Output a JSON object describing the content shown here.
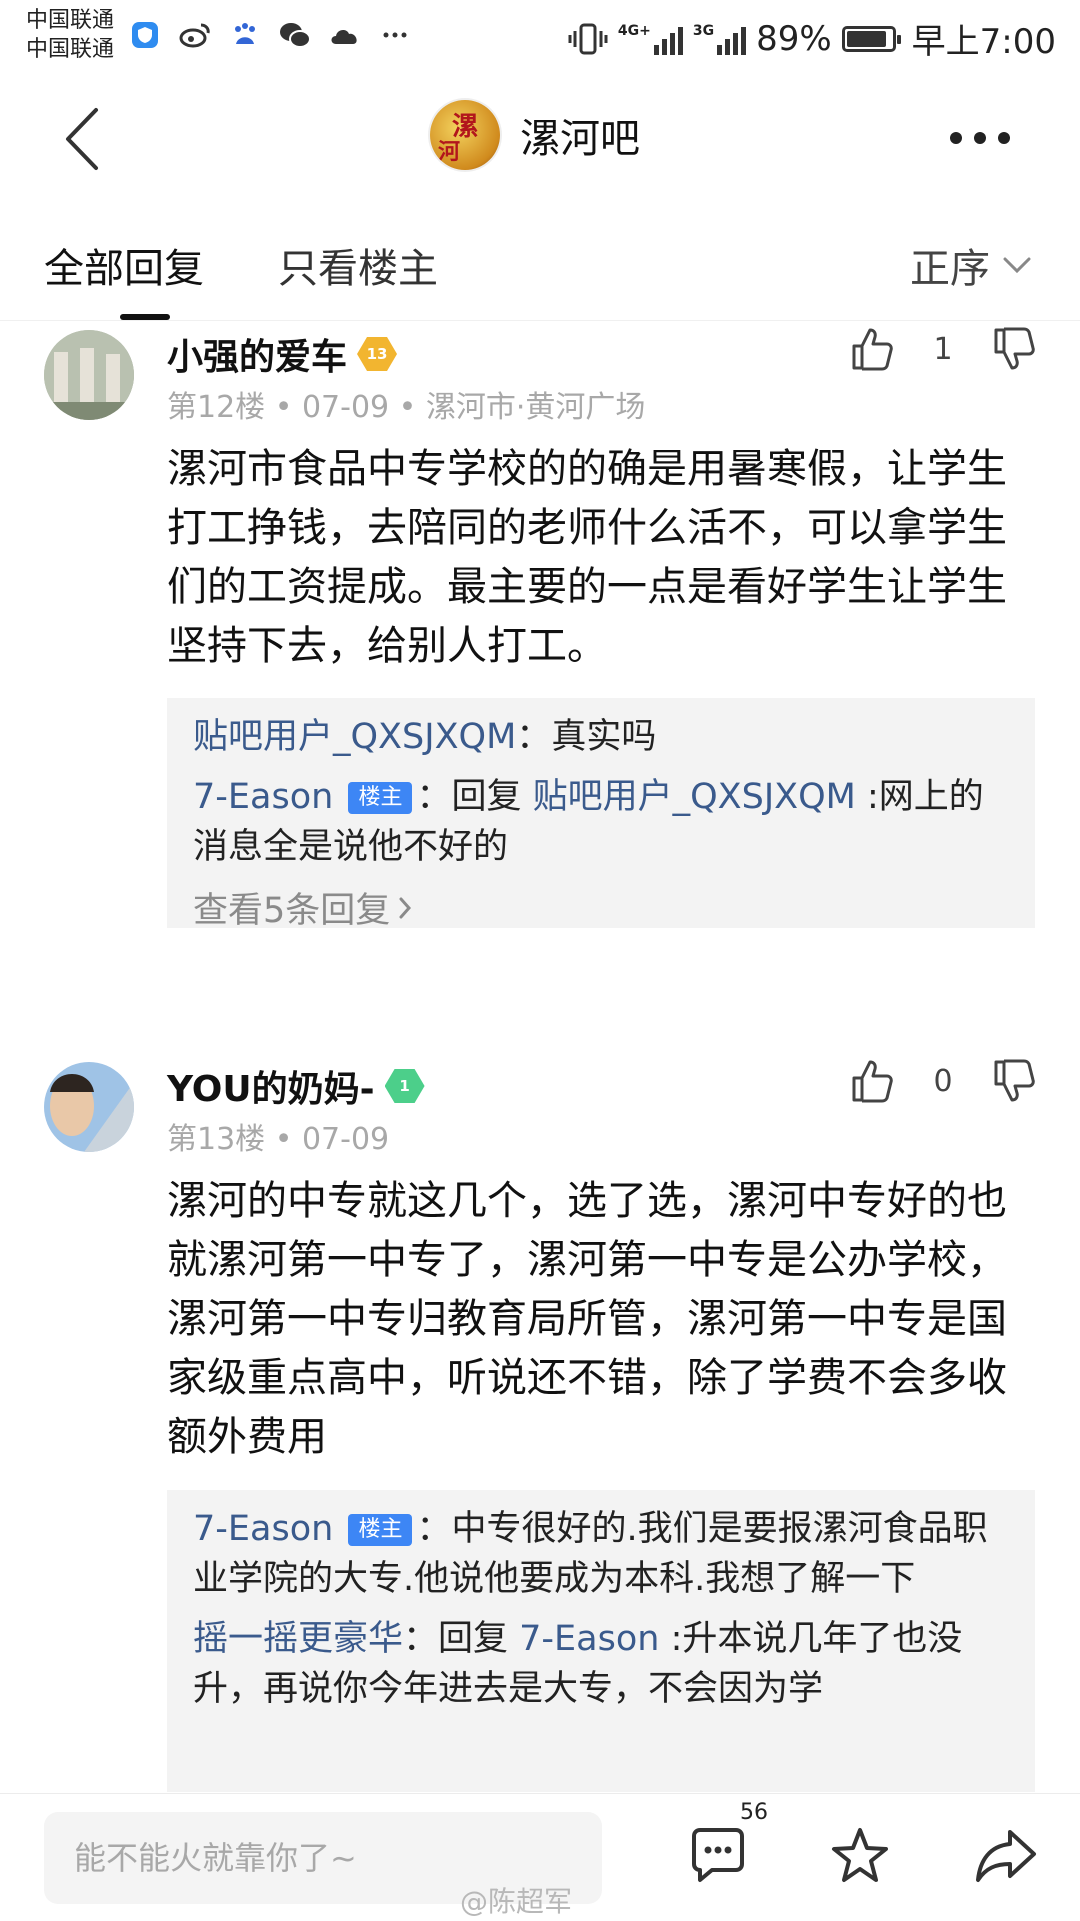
{
  "status": {
    "carrier1": "中国联通",
    "carrier2": "中国联通",
    "sig1_tag": "4G+",
    "sig2_tag": "3G",
    "battery": "89%",
    "battery_level": 0.89,
    "time": "早上7:00",
    "app_icons": [
      "shield-app-icon",
      "weibo-icon",
      "baidu-icon",
      "wechat-icon",
      "cloud-icon",
      "more-dots-icon"
    ]
  },
  "nav": {
    "forum_title": "漯河吧",
    "logo_text": "漯河"
  },
  "tabs": {
    "all": "全部回复",
    "op_only": "只看楼主",
    "sort": "正序"
  },
  "posts": [
    {
      "username": "小强的爱车",
      "level": "13",
      "level_color": "#f2b530",
      "meta": "第12楼 • 07-09 • 漯河市·黄河广场",
      "likes": "1",
      "body": "漯河市食品中专学校的的确是用暑寒假，让学生打工挣钱，去陪同的老师什么活不，可以拿学生们的工资提成。最主要的一点是看好学生让学生坚持下去，给别人打工。",
      "replies": [
        {
          "user": "贴吧用户_QXSJXQM",
          "sep": "：",
          "text": "真实吗"
        },
        {
          "user": "7-Eason",
          "badge": "楼主",
          "sep": "：回复 ",
          "target": "贴吧用户_QXSJXQM",
          "text": " :网上的消息全是说他不好的"
        }
      ],
      "view_more": "查看5条回复"
    },
    {
      "username": "YOU的奶妈-",
      "level": "1",
      "level_color": "#4ccf8a",
      "meta": "第13楼 • 07-09",
      "likes": "0",
      "body": "漯河的中专就这几个，选了选，漯河中专好的也就漯河第一中专了，漯河第一中专是公办学校，漯河第一中专归教育局所管，漯河第一中专是国家级重点高中，听说还不错，除了学费不会多收额外费用",
      "replies": [
        {
          "user": "7-Eason",
          "badge": "楼主",
          "sep": "：",
          "text": "中专很好的.我们是要报漯河食品职业学院的大专.他说他要成为本科.我想了解一下"
        },
        {
          "user": "摇一摇更豪华",
          "sep": "：回复 ",
          "target": "7-Eason",
          "text": " :升本说几年了也没升，再说你今年进去是大专，不会因为学"
        }
      ]
    }
  ],
  "bottom": {
    "input_placeholder": "能不能火就靠你了~",
    "comment_count": "56",
    "watermark": "@陈超军"
  }
}
